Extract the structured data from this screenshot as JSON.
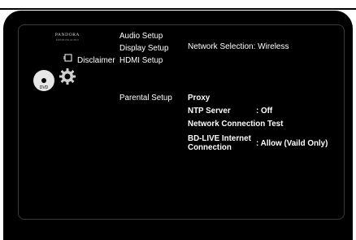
{
  "brand": {
    "name": "PANDORA",
    "tagline": "PREMIUM AUDIO"
  },
  "left_icons": {
    "disc_label": "DVD"
  },
  "disclaimer": {
    "label": "Disclaimer"
  },
  "menu_top": [
    "Audio Setup",
    "Display Setup",
    "HDMI Setup"
  ],
  "menu_bottom": [
    "Parental Setup"
  ],
  "network_selection": {
    "label": "Network Selection",
    "value": "Wireless"
  },
  "network_items": [
    {
      "label": "Proxy",
      "value": ""
    },
    {
      "label": "NTP Server",
      "value": ": Off"
    },
    {
      "label": "Network Connection Test",
      "value": ""
    }
  ],
  "bd_live": {
    "label_line1": "BD-LIVE Internet",
    "label_line2": "Connection",
    "value": ": Allow (Vaild Only)"
  },
  "colors": {
    "background": "#000000",
    "text": "#ffffff",
    "frame": "#3a3a3a"
  }
}
